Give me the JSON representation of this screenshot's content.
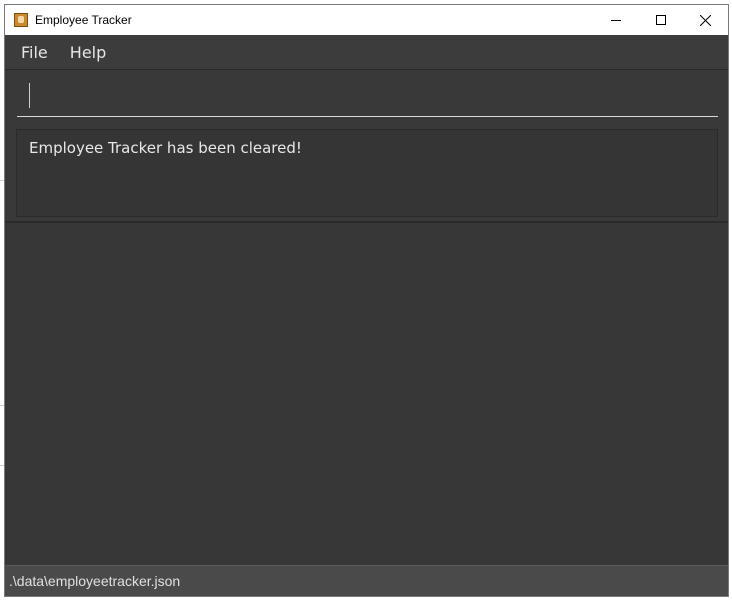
{
  "window": {
    "title": "Employee Tracker"
  },
  "menu": {
    "items": [
      "File",
      "Help"
    ]
  },
  "command": {
    "value": "",
    "placeholder": ""
  },
  "result": {
    "message": "Employee Tracker has been cleared!"
  },
  "status": {
    "path": ".\\data\\employeetracker.json"
  },
  "icons": {
    "app": "app-icon",
    "minimize": "minimize-icon",
    "maximize": "maximize-icon",
    "close": "close-icon"
  },
  "colors": {
    "background": "#3a3a3a",
    "titlebar": "#ffffff",
    "statusbar": "#4a4a4a",
    "text": "#e6e6e6"
  }
}
